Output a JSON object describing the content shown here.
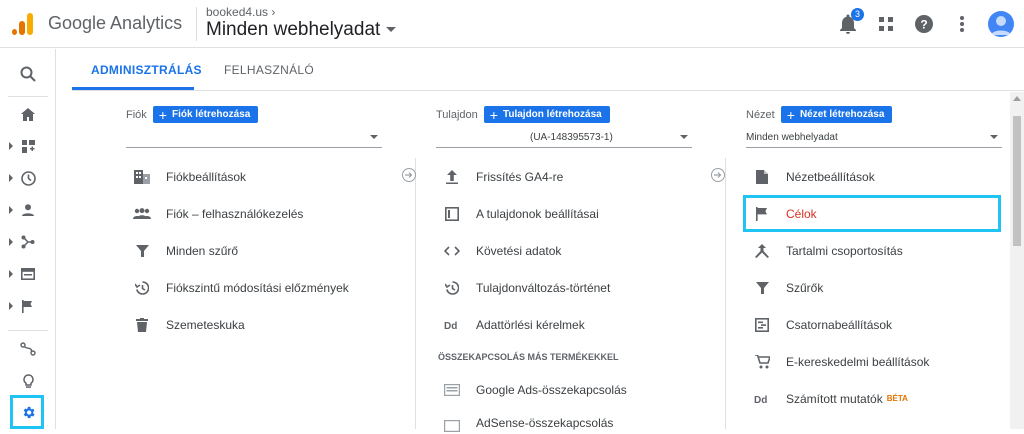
{
  "header": {
    "app_title": "Google Analytics",
    "breadcrumb": "booked4.us",
    "view_name": "Minden webhelyadat",
    "notification_count": "3"
  },
  "sidebar": {
    "icons": [
      "search-icon",
      "home-icon",
      "customization-icon",
      "realtime-icon",
      "audience-icon",
      "acquisition-icon",
      "behavior-icon",
      "conversions-icon",
      "attribution-icon",
      "discover-icon",
      "admin-gear-icon"
    ]
  },
  "tabs": {
    "admin": "ADMINISZTRÁLÁS",
    "user": "FELHASZNÁLÓ"
  },
  "account": {
    "label": "Fiók",
    "create": "Fiók létrehozása",
    "selected": "",
    "items": [
      {
        "icon": "building-icon",
        "label": "Fiókbeállítások"
      },
      {
        "icon": "people-icon",
        "label": "Fiók – felhasználókezelés"
      },
      {
        "icon": "filter-icon",
        "label": "Minden szűrő"
      },
      {
        "icon": "history-icon",
        "label": "Fiókszintű módosítási előzmények"
      },
      {
        "icon": "trash-icon",
        "label": "Szemeteskuka"
      }
    ]
  },
  "property": {
    "label": "Tulajdon",
    "create": "Tulajdon létrehozása",
    "selected": "(UA-148395573-1)",
    "items": [
      {
        "icon": "upgrade-arrow-icon",
        "label": "Frissítés GA4-re"
      },
      {
        "icon": "window-icon",
        "label": "A tulajdonok beállításai"
      },
      {
        "icon": "code-icon",
        "label": "Követési adatok"
      },
      {
        "icon": "history-icon",
        "label": "Tulajdonváltozás-történet"
      },
      {
        "icon": "dd-icon",
        "label": "Adattörlési kérelmek"
      }
    ],
    "section_label": "ÖSSZEKAPCSOLÁS MÁS TERMÉKEKKEL",
    "link_items": [
      {
        "icon": "google-ads-icon",
        "label": "Google Ads-összekapcsolás"
      },
      {
        "icon": "adsense-icon",
        "label": "AdSense-összekapcsolás"
      }
    ]
  },
  "view": {
    "label": "Nézet",
    "create": "Nézet létrehozása",
    "selected": "Minden webhelyadat",
    "items": [
      {
        "icon": "document-icon",
        "label": "Nézetbeállítások"
      },
      {
        "icon": "flag-icon",
        "label": "Célok"
      },
      {
        "icon": "content-grouping-icon",
        "label": "Tartalmi csoportosítás"
      },
      {
        "icon": "filter-icon",
        "label": "Szűrők"
      },
      {
        "icon": "channel-settings-icon",
        "label": "Csatornabeállítások"
      },
      {
        "icon": "cart-icon",
        "label": "E-kereskedelmi beállítások"
      },
      {
        "icon": "dd-icon",
        "label": "Számított mutatók",
        "badge": "BÉTA"
      }
    ]
  },
  "colors": {
    "accent": "#1a73e8",
    "highlight": "#20c4f4",
    "selected_text": "#d93025"
  }
}
